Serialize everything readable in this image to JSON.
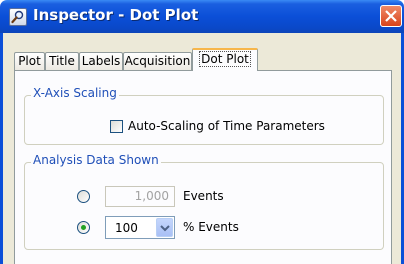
{
  "window": {
    "title": "Inspector - Dot Plot",
    "icon": "magnifier-icon",
    "close_icon": "close-icon"
  },
  "tabs": [
    {
      "label": "Plot"
    },
    {
      "label": "Title"
    },
    {
      "label": "Labels"
    },
    {
      "label": "Acquisition"
    },
    {
      "label": "Dot Plot",
      "active": true
    }
  ],
  "x_axis_scaling": {
    "legend": "X-Axis Scaling",
    "auto_scaling_label": "Auto-Scaling of Time Parameters",
    "auto_scaling_checked": false
  },
  "analysis_data": {
    "legend": "Analysis Data Shown",
    "events_option": {
      "value": "1,000",
      "label": "Events",
      "selected": false,
      "enabled": false
    },
    "percent_option": {
      "value": "100",
      "label": "% Events",
      "selected": true
    }
  },
  "colors": {
    "titlebar": "#0b4fd8",
    "legend_text": "#1f4fb8",
    "active_tab_highlight": "#f7b64a",
    "radio_selected": "#21a121",
    "close_button": "#d8431b"
  }
}
